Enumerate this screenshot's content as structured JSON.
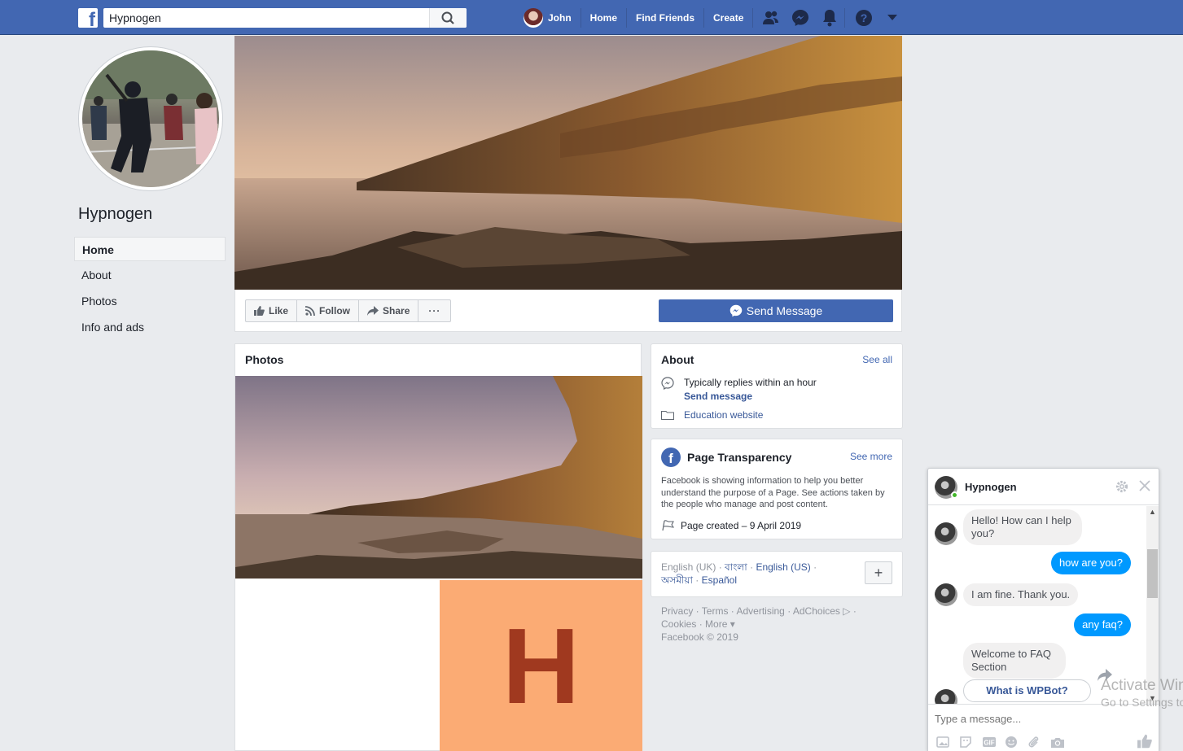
{
  "topbar": {
    "search_value": "Hypnogen",
    "user_name": "John",
    "nav": [
      "Home",
      "Find Friends",
      "Create"
    ],
    "icons": [
      "friends-icon",
      "messenger-icon",
      "notifications-icon",
      "help-icon",
      "dropdown-icon"
    ]
  },
  "page": {
    "name": "Hypnogen",
    "left_nav": [
      "Home",
      "About",
      "Photos",
      "Info and ads"
    ]
  },
  "actions": {
    "like": "Like",
    "follow": "Follow",
    "share": "Share",
    "more": "···",
    "send_message": "Send Message"
  },
  "photos": {
    "title": "Photos",
    "tile_letter": "H",
    "tile_bg": "#fbab74",
    "tile_fg": "#a0391f"
  },
  "about": {
    "title": "About",
    "see_all": "See all",
    "reply_text": "Typically replies within an hour",
    "send_message_link": "Send message",
    "category": "Education website"
  },
  "transparency": {
    "title": "Page Transparency",
    "see_more": "See more",
    "description": "Facebook is showing information to help you better understand the purpose of a Page. See actions taken by the people who manage and post content.",
    "created": "Page created – 9 April 2019"
  },
  "languages": {
    "current": "English (UK)",
    "links": [
      "বাংলা",
      "English (US)",
      "অসমীয়া",
      "Español"
    ],
    "add": "+"
  },
  "footer": {
    "links": [
      "Privacy",
      "Terms",
      "Advertising",
      "AdChoices",
      "Cookies",
      "More"
    ],
    "copyright": "Facebook © 2019"
  },
  "chat": {
    "name": "Hypnogen",
    "messages": [
      {
        "from": "bot",
        "text": "Hello! How can I help you?"
      },
      {
        "from": "user",
        "text": "how are you?"
      },
      {
        "from": "bot",
        "text": "I am fine. Thank you."
      },
      {
        "from": "user",
        "text": "any faq?"
      },
      {
        "from": "bot",
        "text": "Welcome to FAQ Section"
      }
    ],
    "quick_reply": "What is WPBot?",
    "input_placeholder": "Type a message..."
  },
  "watermark": {
    "line1": "Activate Windows",
    "line2": "Go to Settings to activate Windows."
  },
  "colors": {
    "brand": "#4267b2",
    "background": "#e9ebee",
    "messenger_blue": "#0099ff"
  }
}
